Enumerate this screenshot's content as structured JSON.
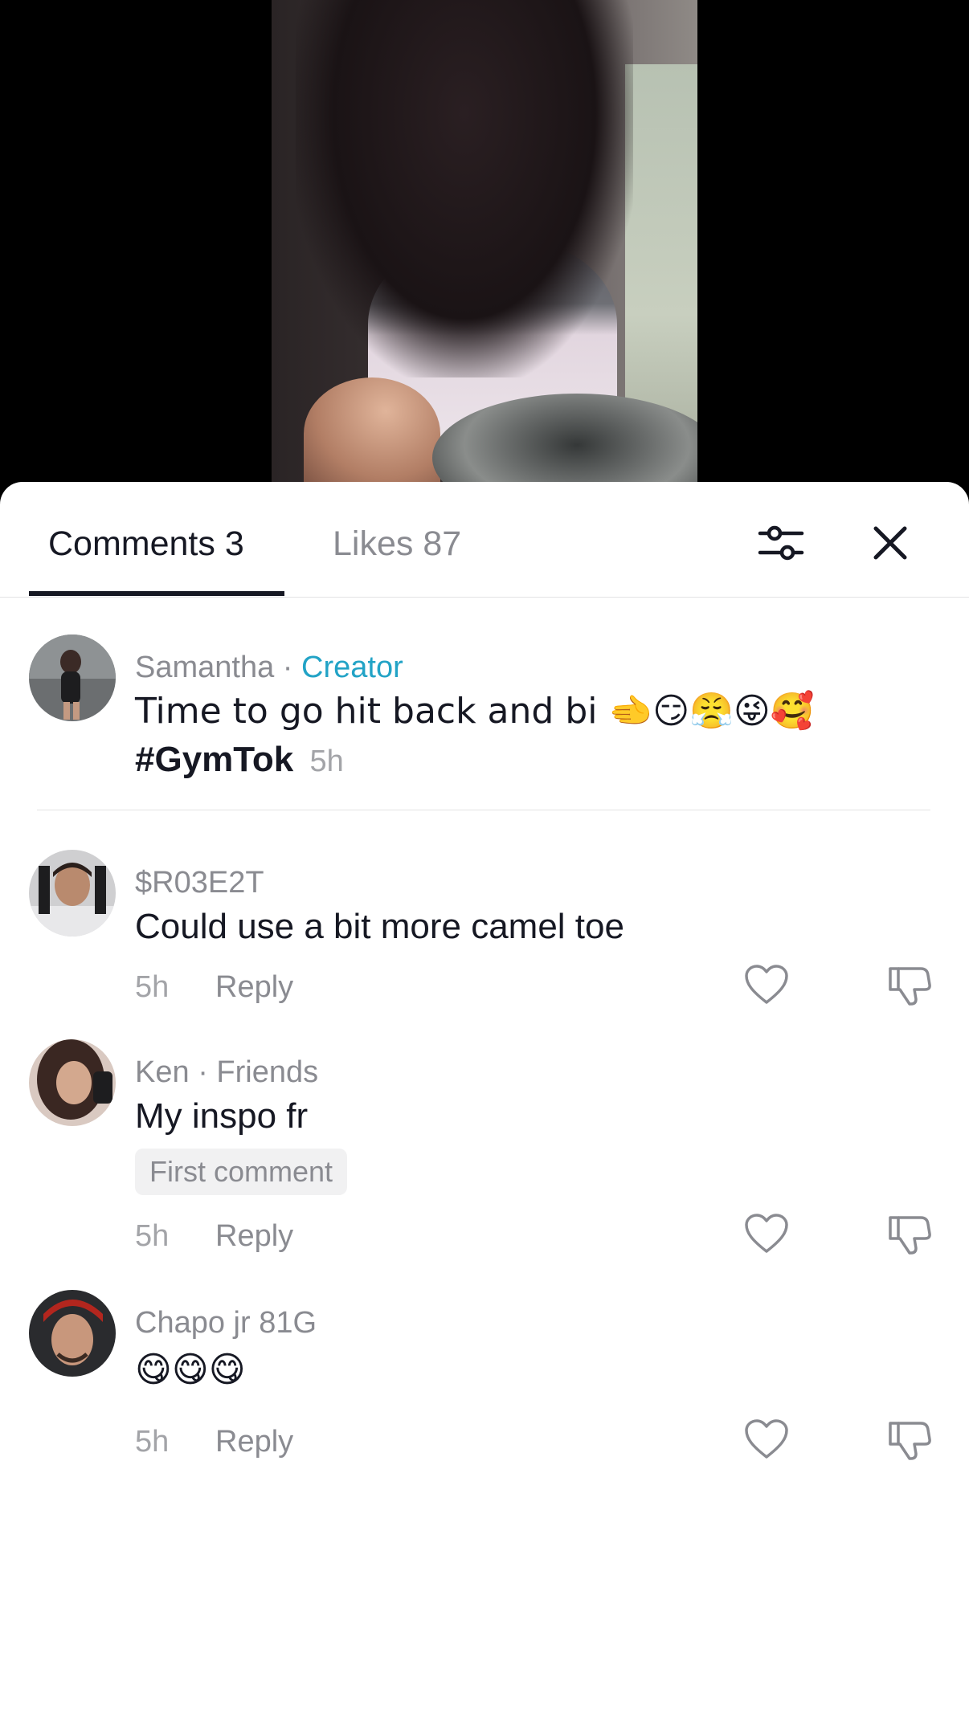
{
  "tabs": {
    "comments_label": "Comments 3",
    "likes_label": "Likes 87"
  },
  "comments": [
    {
      "username": "Samantha",
      "separator": "·",
      "role": "Creator",
      "text_line1": "Time to go hit back and bi 🫲😏😤😜🥰",
      "text_hashtag": "#GymTok",
      "time": "5h"
    },
    {
      "username": "$R03E2T",
      "text": "Could use a bit more camel toe",
      "time": "5h",
      "reply_label": "Reply"
    },
    {
      "username": "Ken",
      "separator": "·",
      "relation": "Friends",
      "text": "My inspo fr",
      "badge": "First comment",
      "time": "5h",
      "reply_label": "Reply"
    },
    {
      "username": "Chapo jr 81G",
      "text": "😋😋😋",
      "time": "5h",
      "reply_label": "Reply"
    }
  ],
  "colors": {
    "accent_creator": "#22a3c6",
    "text_primary": "#161823",
    "text_secondary": "#8a8b91"
  },
  "icons": [
    "filter-icon",
    "close-icon",
    "heart-icon",
    "dislike-icon"
  ]
}
